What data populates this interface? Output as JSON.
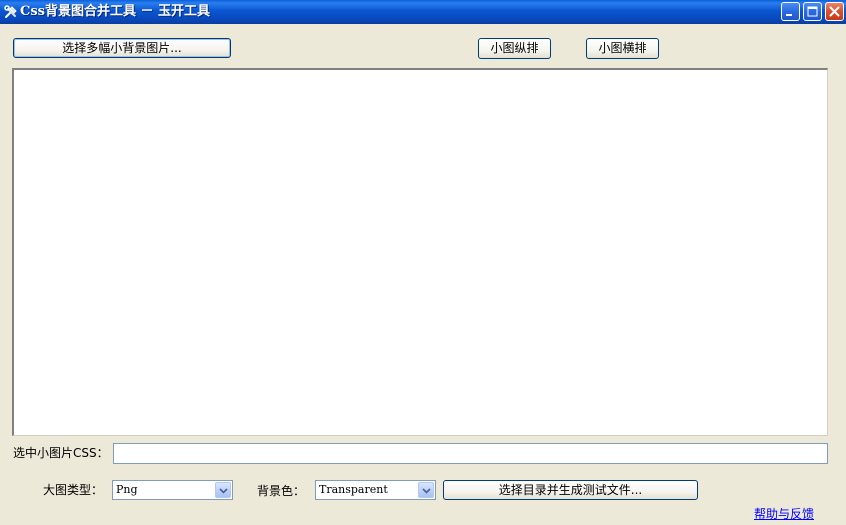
{
  "window": {
    "title": "Css背景图合并工具 － 玉开工具",
    "app_icon": "tools-icon",
    "controls": {
      "minimize_icon": "minimize-icon",
      "maximize_icon": "maximize-icon",
      "close_icon": "close-icon"
    }
  },
  "toolbar": {
    "select_images_label": "选择多幅小背景图片...",
    "vertical_label": "小图纵排",
    "horizontal_label": "小图横排"
  },
  "css_field": {
    "label": "选中小图片CSS：",
    "value": "",
    "placeholder": ""
  },
  "options": {
    "image_type_label": "大图类型：",
    "image_type_value": "Png",
    "bg_color_label": "背景色：",
    "bg_color_value": "Transparent",
    "generate_label": "选择目录并生成测试文件..."
  },
  "footer": {
    "help_link": "帮助与反馈"
  },
  "colors": {
    "titlebar": "#0a56d0",
    "window_bg": "#ece9d8",
    "button_border": "#003c74",
    "link": "#0000ff",
    "close_button": "#d8502f"
  }
}
